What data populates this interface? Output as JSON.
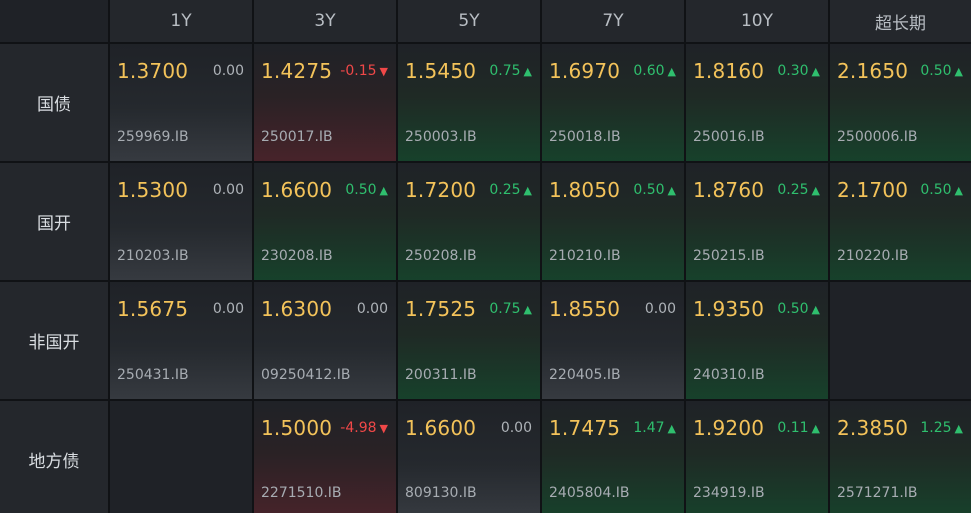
{
  "columns": [
    "1Y",
    "3Y",
    "5Y",
    "7Y",
    "10Y",
    "超长期"
  ],
  "rows": [
    {
      "label": "国债",
      "cells": [
        {
          "rate": "1.3700",
          "change": "0.00",
          "dir": "flat",
          "code": "259969.IB"
        },
        {
          "rate": "1.4275",
          "change": "-0.15",
          "dir": "down",
          "code": "250017.IB"
        },
        {
          "rate": "1.5450",
          "change": "0.75",
          "dir": "up",
          "code": "250003.IB"
        },
        {
          "rate": "1.6970",
          "change": "0.60",
          "dir": "up",
          "code": "250018.IB"
        },
        {
          "rate": "1.8160",
          "change": "0.30",
          "dir": "up",
          "code": "250016.IB"
        },
        {
          "rate": "2.1650",
          "change": "0.50",
          "dir": "up",
          "code": "2500006.IB"
        }
      ]
    },
    {
      "label": "国开",
      "cells": [
        {
          "rate": "1.5300",
          "change": "0.00",
          "dir": "flat",
          "code": "210203.IB"
        },
        {
          "rate": "1.6600",
          "change": "0.50",
          "dir": "up",
          "code": "230208.IB"
        },
        {
          "rate": "1.7200",
          "change": "0.25",
          "dir": "up",
          "code": "250208.IB"
        },
        {
          "rate": "1.8050",
          "change": "0.50",
          "dir": "up",
          "code": "210210.IB"
        },
        {
          "rate": "1.8760",
          "change": "0.25",
          "dir": "up",
          "code": "250215.IB"
        },
        {
          "rate": "2.1700",
          "change": "0.50",
          "dir": "up",
          "code": "210220.IB"
        }
      ]
    },
    {
      "label": "非国开",
      "cells": [
        {
          "rate": "1.5675",
          "change": "0.00",
          "dir": "flat",
          "code": "250431.IB"
        },
        {
          "rate": "1.6300",
          "change": "0.00",
          "dir": "flat",
          "code": "09250412.IB"
        },
        {
          "rate": "1.7525",
          "change": "0.75",
          "dir": "up",
          "code": "200311.IB"
        },
        {
          "rate": "1.8550",
          "change": "0.00",
          "dir": "flat",
          "code": "220405.IB"
        },
        {
          "rate": "1.9350",
          "change": "0.50",
          "dir": "up",
          "code": "240310.IB"
        },
        null
      ]
    },
    {
      "label": "地方债",
      "cells": [
        null,
        {
          "rate": "1.5000",
          "change": "-4.98",
          "dir": "down",
          "code": "2271510.IB"
        },
        {
          "rate": "1.6600",
          "change": "0.00",
          "dir": "flat",
          "code": "809130.IB"
        },
        {
          "rate": "1.7475",
          "change": "1.47",
          "dir": "up",
          "code": "2405804.IB"
        },
        {
          "rate": "1.9200",
          "change": "0.11",
          "dir": "up",
          "code": "234919.IB"
        },
        {
          "rate": "2.3850",
          "change": "1.25",
          "dir": "up",
          "code": "2571271.IB"
        }
      ]
    }
  ],
  "colors": {
    "rate": "#f3c35a",
    "up": "#2fbf6e",
    "down": "#f04848",
    "flat": "#aeb3b8"
  },
  "icons": {
    "up": "triangle-up-icon",
    "down": "triangle-down-icon"
  }
}
